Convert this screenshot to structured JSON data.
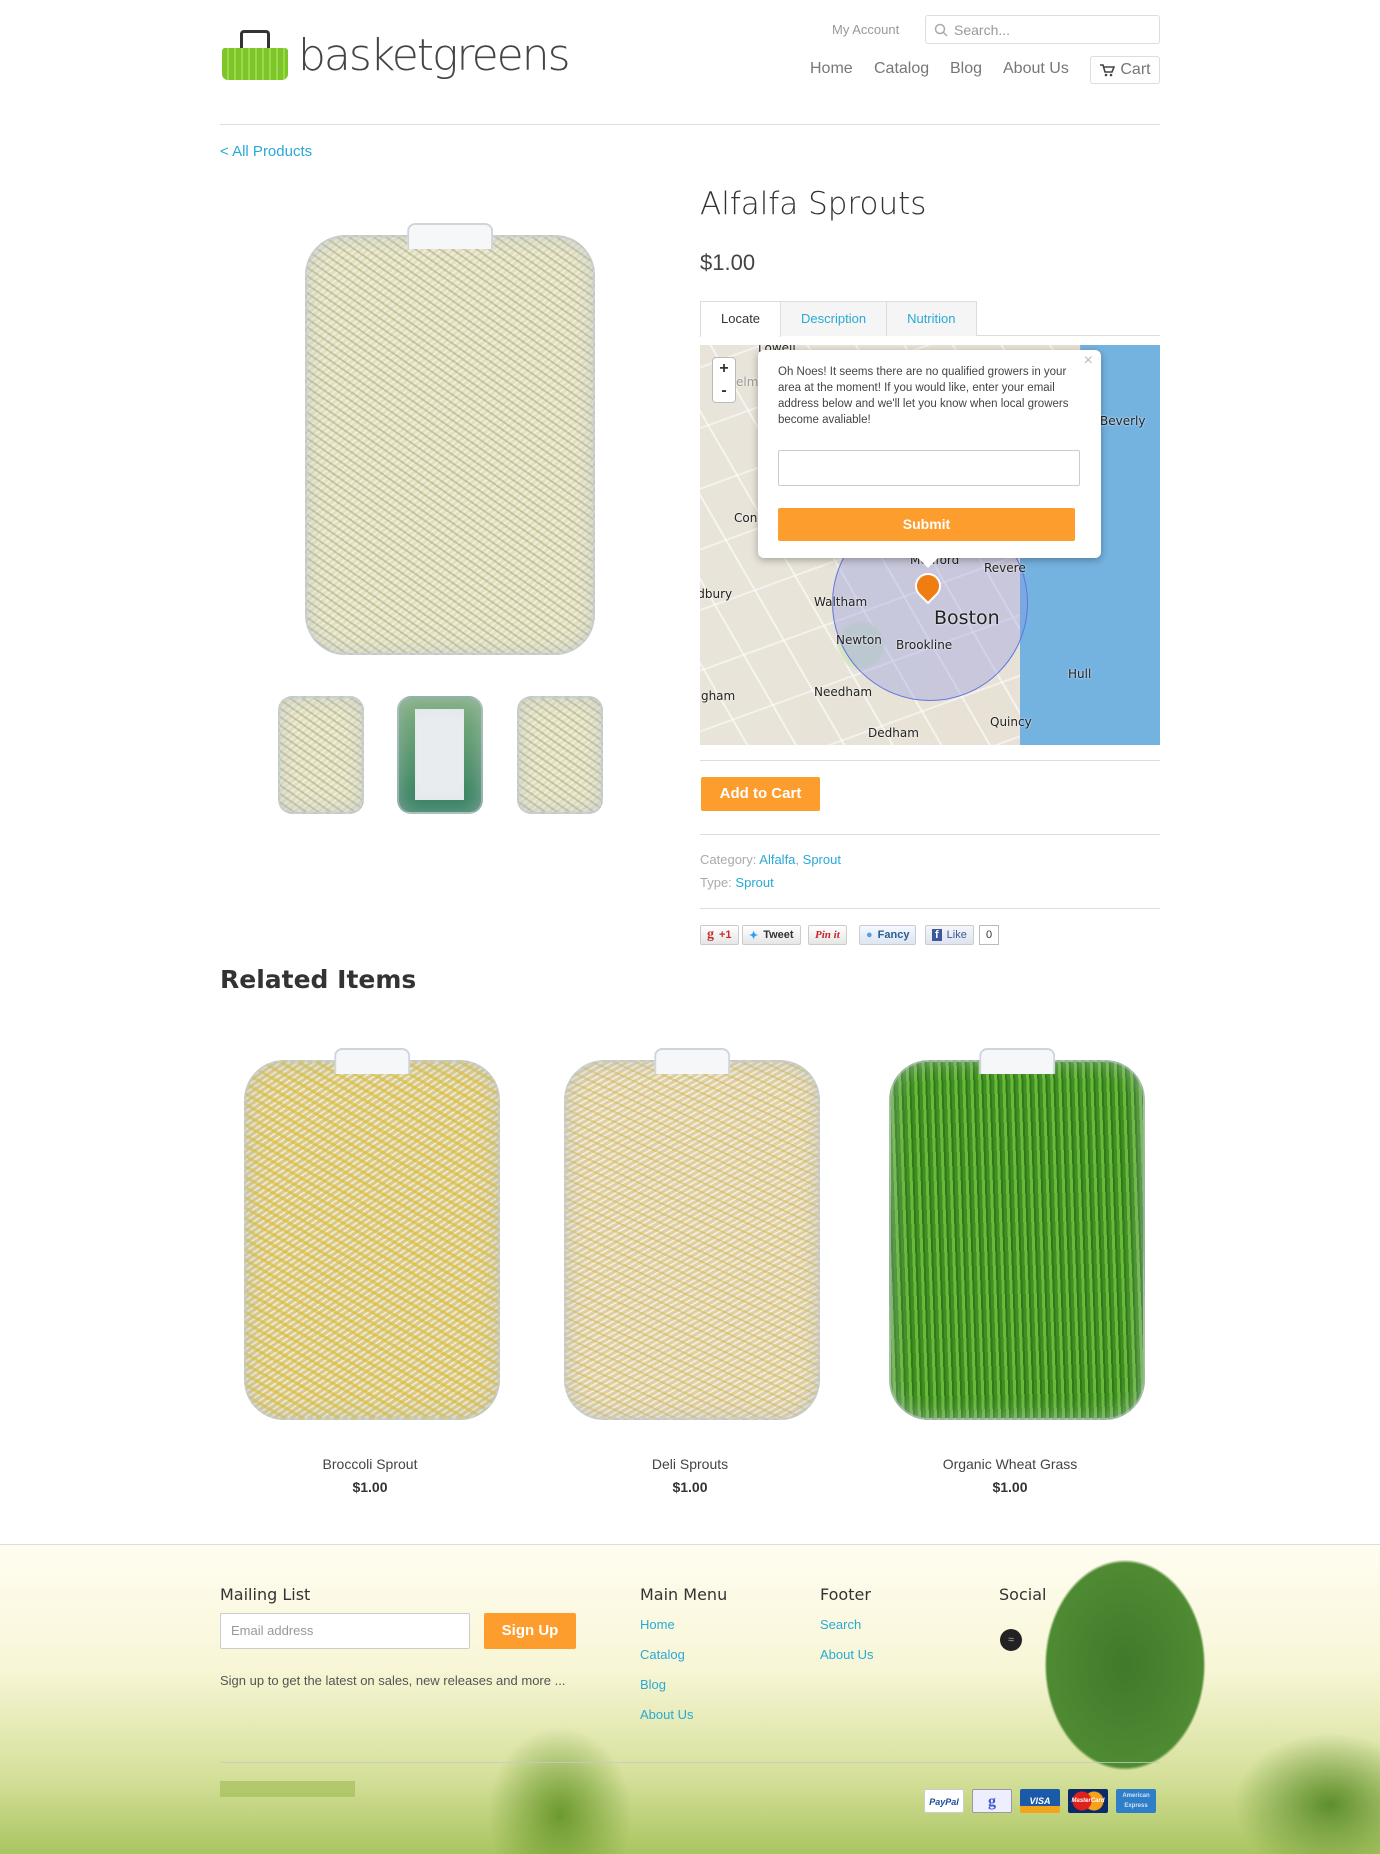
{
  "header": {
    "logo_text": "basketgreens",
    "my_account": "My Account",
    "search_placeholder": "Search...",
    "nav": [
      "Home",
      "Catalog",
      "Blog",
      "About Us"
    ],
    "cart": "Cart"
  },
  "breadcrumb": "< All Products",
  "product": {
    "title": "Alfalfa Sprouts",
    "price": "$1.00",
    "tabs": [
      "Locate",
      "Description",
      "Nutrition"
    ],
    "active_tab": "Locate",
    "map": {
      "labels": [
        "Lowell",
        "Chelmsford",
        "Concord",
        "Sudbury",
        "Waltham",
        "Medford",
        "Revere",
        "Boston",
        "Newton",
        "Brookline",
        "Needham",
        "Framingham",
        "Hull",
        "Quincy",
        "Dedham",
        "Beverly"
      ],
      "zoom_in": "+",
      "zoom_out": "-"
    },
    "popup": {
      "message": "Oh Noes! It seems there are no qualified growers in your area at the moment! If you would like, enter your email address below and we'll let you know when local growers become avaliable!",
      "email_value": "",
      "submit": "Submit",
      "close": "×"
    },
    "add_to_cart": "Add to Cart",
    "category_label": "Category:",
    "categories": [
      "Alfalfa",
      "Sprout"
    ],
    "type_label": "Type:",
    "type": "Sprout",
    "social": {
      "gplus": "+1",
      "tweet": "Tweet",
      "pin": "Pin it",
      "fancy": "Fancy",
      "like": "Like",
      "like_count": "0"
    }
  },
  "related": {
    "heading": "Related Items",
    "items": [
      {
        "name": "Broccoli Sprout",
        "price": "$1.00"
      },
      {
        "name": "Deli Sprouts",
        "price": "$1.00"
      },
      {
        "name": "Organic Wheat Grass",
        "price": "$1.00"
      }
    ]
  },
  "footer": {
    "mailing_heading": "Mailing List",
    "email_placeholder": "Email address",
    "signup": "Sign Up",
    "blurb": "Sign up to get the latest on sales, new releases and more ...",
    "main_menu_heading": "Main Menu",
    "main_menu": [
      "Home",
      "Catalog",
      "Blog",
      "About Us"
    ],
    "footer_heading": "Footer",
    "footer_links": [
      "Search",
      "About Us"
    ],
    "social_heading": "Social",
    "payments": [
      "PayPal",
      "Google",
      "VISA",
      "MasterCard",
      "American Express"
    ]
  },
  "colors": {
    "accent": "#fc9d2e",
    "link": "#29a9d6",
    "logo_green": "#7cc62a"
  }
}
